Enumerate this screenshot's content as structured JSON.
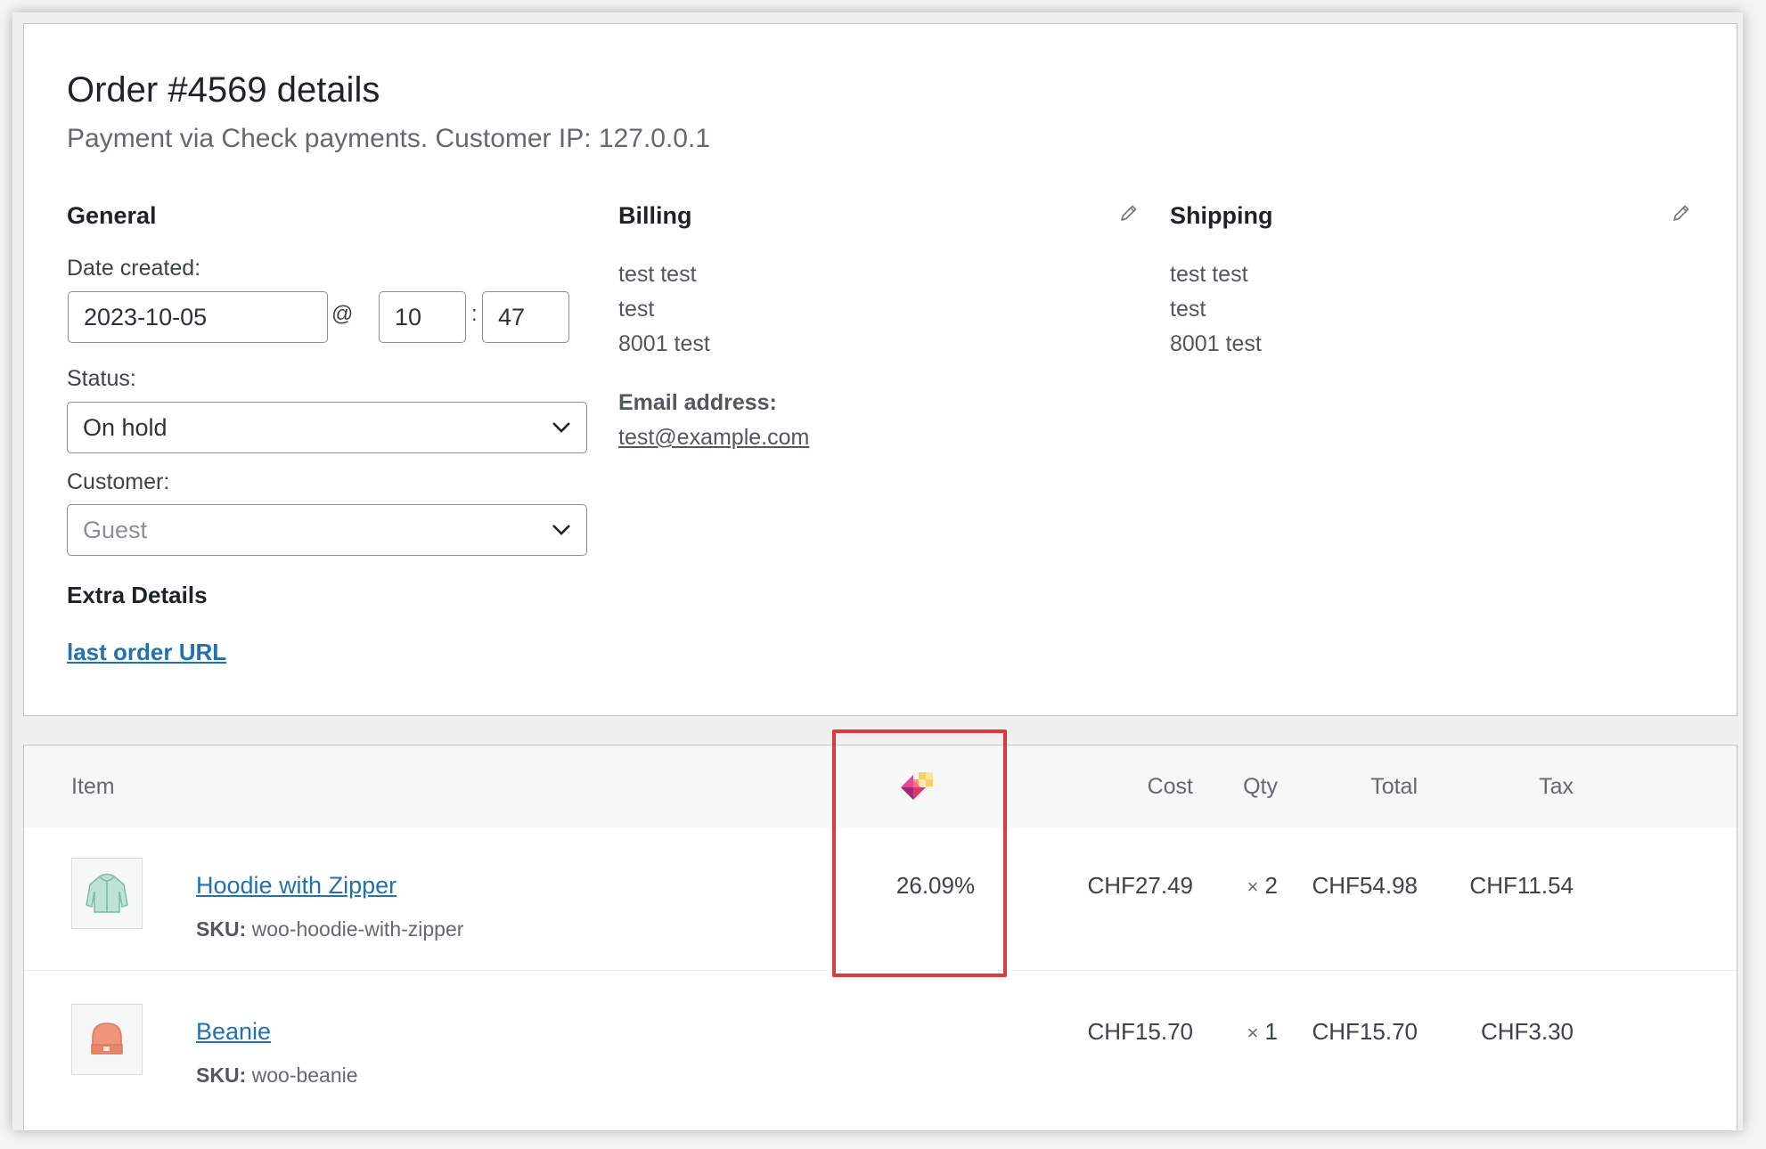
{
  "order": {
    "title": "Order #4569 details",
    "subtitle": "Payment via Check payments. Customer IP: 127.0.0.1"
  },
  "general": {
    "heading": "General",
    "date_label": "Date created:",
    "date_value": "2023-10-05",
    "at_sign": "@",
    "hour_value": "10",
    "colon": ":",
    "minute_value": "47",
    "status_label": "Status:",
    "status_value": "On hold",
    "customer_label": "Customer:",
    "customer_value": "Guest",
    "extra_heading": "Extra Details",
    "extra_link": "last order URL"
  },
  "billing": {
    "heading": "Billing",
    "lines": [
      "test test",
      "test",
      "8001 test"
    ],
    "email_label": "Email address:",
    "email": "test@example.com",
    "edit_icon": "pencil-icon"
  },
  "shipping": {
    "heading": "Shipping",
    "lines": [
      "test test",
      "test",
      "8001 test"
    ],
    "edit_icon": "pencil-icon"
  },
  "items_table": {
    "headers": {
      "item": "Item",
      "plugin_icon": "plugin-logo-icon",
      "cost": "Cost",
      "qty": "Qty",
      "total": "Total",
      "tax": "Tax"
    },
    "rows": [
      {
        "name": "Hoodie with Zipper",
        "sku_label": "SKU:",
        "sku": "woo-hoodie-with-zipper",
        "metric": "26.09%",
        "cost": "CHF27.49",
        "qty_symbol": "×",
        "qty": "2",
        "total": "CHF54.98",
        "tax": "CHF11.54"
      },
      {
        "name": "Beanie",
        "sku_label": "SKU:",
        "sku": "woo-beanie",
        "metric": "",
        "cost": "CHF15.70",
        "qty_symbol": "×",
        "qty": "1",
        "total": "CHF15.70",
        "tax": "CHF3.30"
      }
    ]
  },
  "colors": {
    "link": "#2271b1",
    "highlight": "#e0383f",
    "panel_border": "#c3c4c7"
  }
}
